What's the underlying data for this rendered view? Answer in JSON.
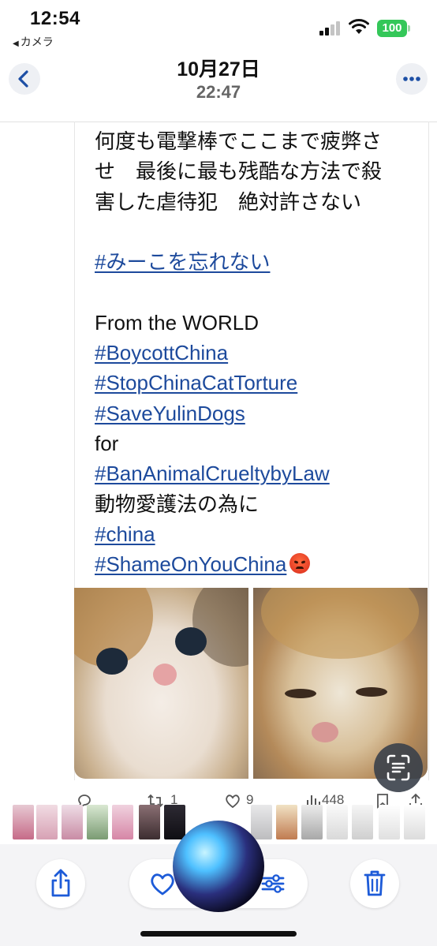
{
  "status_bar": {
    "time": "12:54",
    "back_app_label": "カメラ",
    "battery": "100",
    "battery_color": "#34c759"
  },
  "header": {
    "date": "10月27日",
    "time": "22:47",
    "back_icon": "chevron-left-icon",
    "more_icon": "ellipsis-icon",
    "accent_color": "#1d4fa5"
  },
  "tweet": {
    "lines": [
      {
        "text": "何度も電撃棒でここまで疲弊さ",
        "link": false
      },
      {
        "text": "せ　最後に最も残酷な方法で殺",
        "link": false
      },
      {
        "text": "害した虐待犯　絶対許さない",
        "link": false
      },
      {
        "text": "",
        "link": false
      },
      {
        "text": "#みーこを忘れない",
        "link": true
      },
      {
        "text": "",
        "link": false
      },
      {
        "text": "From the WORLD",
        "link": false
      },
      {
        "text": "#BoycottChina",
        "link": true
      },
      {
        "text": "#StopChinaCatTorture",
        "link": true
      },
      {
        "text": "#SaveYulinDogs",
        "link": true
      },
      {
        "text": "for",
        "link": false
      },
      {
        "text": "#BanAnimalCrueltybyLaw",
        "link": true
      },
      {
        "text": "動物愛護法の為に",
        "link": false
      },
      {
        "text": "#china",
        "link": true
      },
      {
        "text": "#ShameOnYouChina",
        "link": true,
        "emoji": "angry-face-emoji"
      }
    ],
    "link_color": "#1d4a9c",
    "images": [
      "kitten-photo",
      "kitten-photo"
    ],
    "actions": {
      "reply_count": "",
      "retweet_count": "1",
      "like_count": "9",
      "views_count": "448"
    }
  },
  "live_text_icon": "live-text-icon",
  "toolbar": {
    "share_icon": "share-icon",
    "favorite_icon": "heart-icon",
    "adjust_icon": "adjust-sliders-icon",
    "delete_icon": "trash-icon",
    "accent_color": "#1d5bd8"
  },
  "overlay": {
    "siri": "siri-orb"
  }
}
